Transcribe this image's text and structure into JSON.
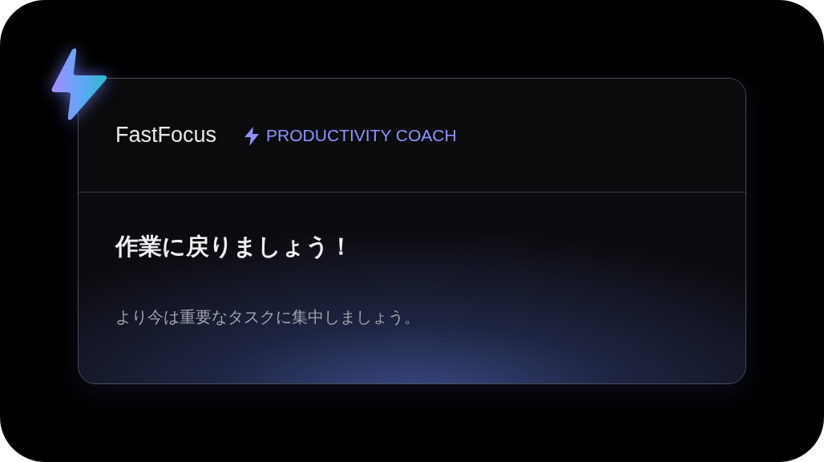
{
  "header": {
    "app_name": "FastFocus",
    "tagline": "PRODUCTIVITY COACH"
  },
  "body": {
    "heading": "作業に戻りましょう！",
    "message": "より今は重要なタスクに集中しましょう。"
  }
}
